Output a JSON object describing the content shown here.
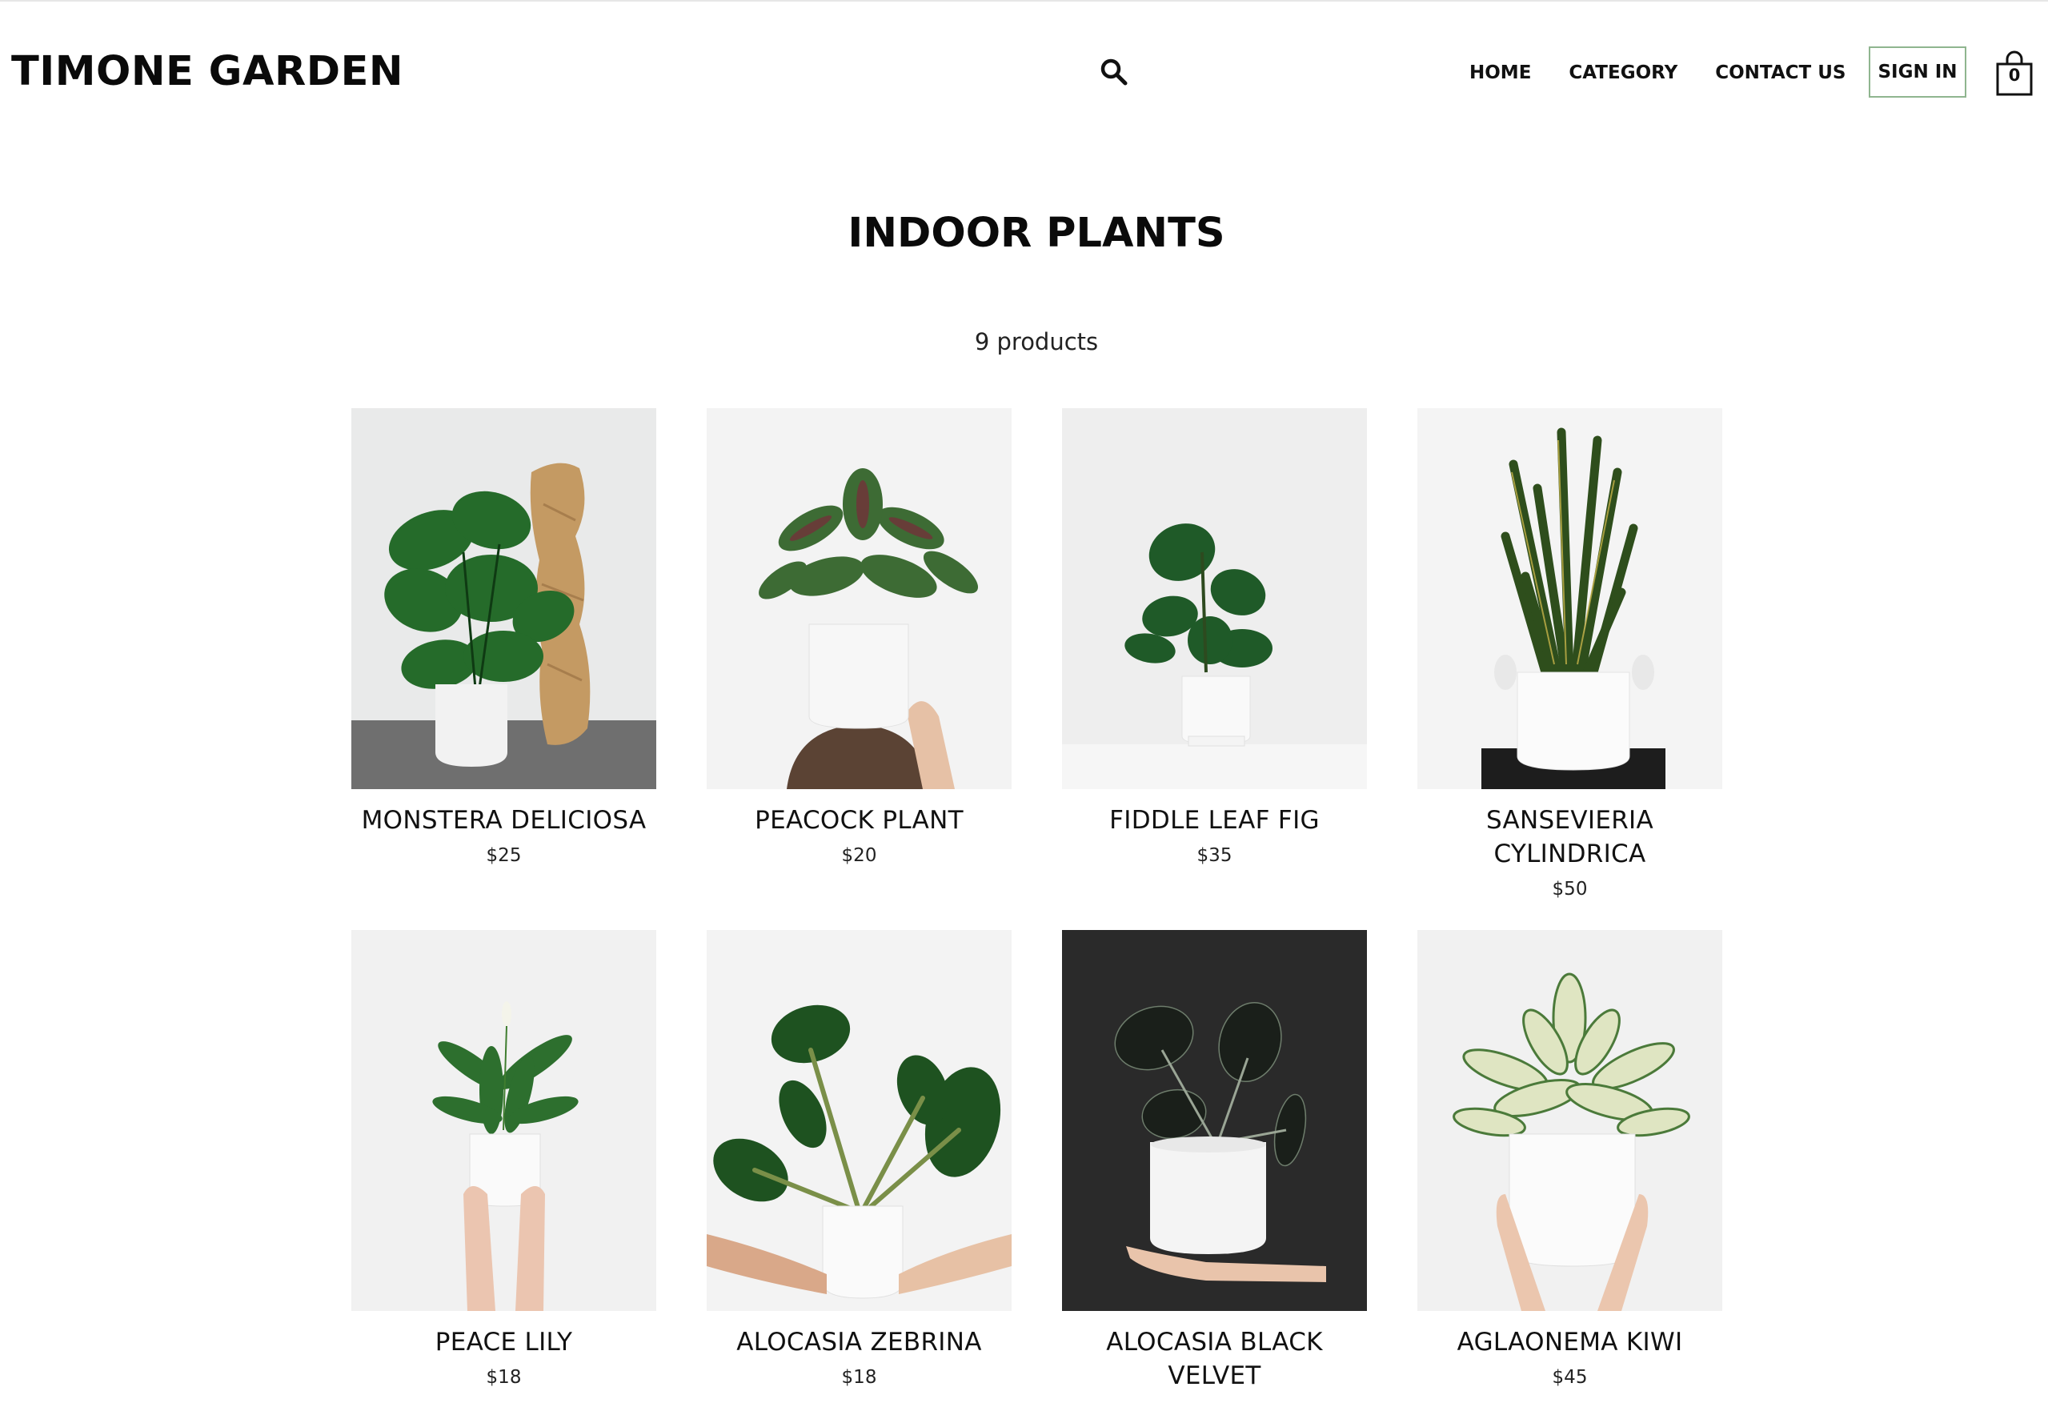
{
  "header": {
    "brand": "TIMONE GARDEN",
    "nav": [
      "HOME",
      "CATEGORY",
      "CONTACT US"
    ],
    "sign_in": "SIGN IN",
    "cart_count": "0"
  },
  "main": {
    "title": "INDOOR PLANTS",
    "product_count": "9 products",
    "products": [
      {
        "name": "MONSTERA DELICIOSA",
        "price": "$25",
        "image": "monstera-photo"
      },
      {
        "name": "PEACOCK PLANT",
        "price": "$20",
        "image": "peacock-plant-photo"
      },
      {
        "name": "FIDDLE LEAF FIG",
        "price": "$35",
        "image": "fiddle-leaf-fig-photo"
      },
      {
        "name": "SANSEVIERIA CYLINDRICA",
        "price": "$50",
        "image": "sansevieria-photo"
      },
      {
        "name": "PEACE LILY",
        "price": "$18",
        "image": "peace-lily-photo"
      },
      {
        "name": "ALOCASIA ZEBRINA",
        "price": "$18",
        "image": "alocasia-zebrina-photo"
      },
      {
        "name": "ALOCASIA BLACK VELVET",
        "price": "",
        "image": "alocasia-black-velvet-photo"
      },
      {
        "name": "AGLAONEMA KIWI",
        "price": "$45",
        "image": "aglaonema-kiwi-photo"
      }
    ]
  },
  "colors": {
    "signin_border": "#8fb58f",
    "leaf_dark": "#1f4d22",
    "leaf": "#2f7a2f",
    "pot": "#f4f4f4"
  }
}
